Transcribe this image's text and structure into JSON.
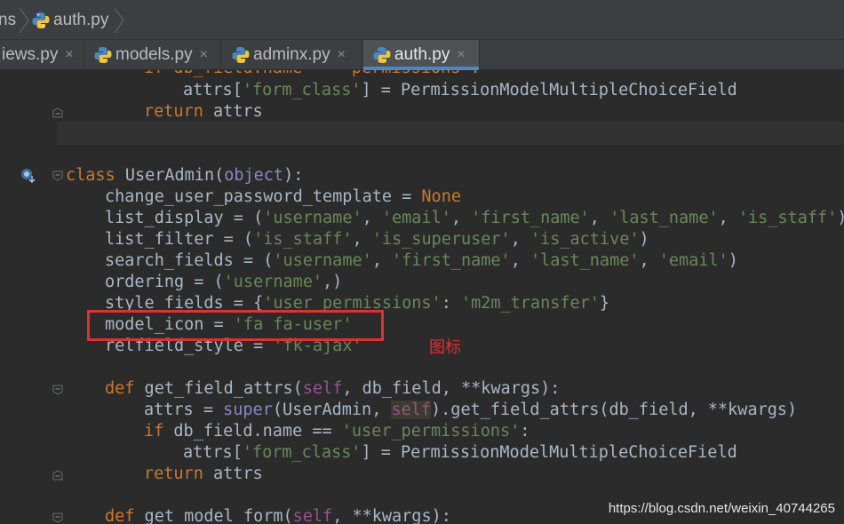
{
  "breadcrumb": {
    "items": [
      {
        "label": "ns"
      },
      {
        "label": "auth.py"
      }
    ]
  },
  "tabs": [
    {
      "label": "iews.py",
      "active": false
    },
    {
      "label": "models.py",
      "active": false
    },
    {
      "label": "adminx.py",
      "active": false
    },
    {
      "label": "auth.py",
      "active": true
    }
  ],
  "close_glyph": "×",
  "code": {
    "lines": [
      [
        [
          "if db_field.name == 'permissions':",
          "kw"
        ]
      ],
      [
        [
          "attrs[",
          ""
        ],
        [
          "'form_class'",
          "str"
        ],
        [
          "] = PermissionModelMultipleChoiceField",
          ""
        ]
      ],
      [
        [
          "return",
          "kw"
        ],
        [
          " attrs",
          ""
        ]
      ],
      [],
      [
        [
          "class",
          "kw"
        ],
        [
          " UserAdmin(",
          ""
        ],
        [
          "object",
          "bi"
        ],
        [
          "):",
          ""
        ]
      ],
      [
        [
          "change_user_password_template = ",
          ""
        ],
        [
          "None",
          "kw"
        ]
      ],
      [
        [
          "list_display = (",
          ""
        ],
        [
          "'username'",
          "str"
        ],
        [
          ", ",
          ""
        ],
        [
          "'email'",
          "str"
        ],
        [
          ", ",
          ""
        ],
        [
          "'first_name'",
          "str"
        ],
        [
          ", ",
          ""
        ],
        [
          "'last_name'",
          "str"
        ],
        [
          ", ",
          ""
        ],
        [
          "'is_staff'",
          "str"
        ],
        [
          ")",
          ""
        ]
      ],
      [
        [
          "list_filter = (",
          ""
        ],
        [
          "'is_staff'",
          "str"
        ],
        [
          ", ",
          ""
        ],
        [
          "'is_superuser'",
          "str"
        ],
        [
          ", ",
          ""
        ],
        [
          "'is_active'",
          "str"
        ],
        [
          ")",
          ""
        ]
      ],
      [
        [
          "search_fields = (",
          ""
        ],
        [
          "'username'",
          "str"
        ],
        [
          ", ",
          ""
        ],
        [
          "'first_name'",
          "str"
        ],
        [
          ", ",
          ""
        ],
        [
          "'last_name'",
          "str"
        ],
        [
          ", ",
          ""
        ],
        [
          "'email'",
          "str"
        ],
        [
          ")",
          ""
        ]
      ],
      [
        [
          "ordering = (",
          ""
        ],
        [
          "'username'",
          "str"
        ],
        [
          ",)",
          ""
        ]
      ],
      [
        [
          "style_fields = {",
          ""
        ],
        [
          "'user_permissions'",
          "str"
        ],
        [
          ": ",
          ""
        ],
        [
          "'m2m_transfer'",
          "str"
        ],
        [
          "}",
          ""
        ]
      ],
      [
        [
          "model_icon = ",
          ""
        ],
        [
          "'fa fa-user'",
          "str"
        ]
      ],
      [
        [
          "relfield_style = ",
          ""
        ],
        [
          "'fk-ajax'",
          "str"
        ]
      ],
      [],
      [
        [
          "def",
          "kw"
        ],
        [
          " get_field_attrs(",
          ""
        ],
        [
          "self",
          "self"
        ],
        [
          ", db_field, **kwargs):",
          ""
        ]
      ],
      [
        [
          "attrs = ",
          ""
        ],
        [
          "super",
          "bi"
        ],
        [
          "(UserAdmin, ",
          ""
        ],
        [
          "self",
          "self"
        ],
        [
          ").get_field_attrs(db_field, **kwargs)",
          ""
        ]
      ],
      [
        [
          "if",
          "kw"
        ],
        [
          " db_field.name == ",
          ""
        ],
        [
          "'user_permissions'",
          "str"
        ],
        [
          ":",
          ""
        ]
      ],
      [
        [
          "attrs[",
          ""
        ],
        [
          "'form_class'",
          "str"
        ],
        [
          "] = PermissionModelMultipleChoiceField",
          ""
        ]
      ],
      [
        [
          "return",
          "kw"
        ],
        [
          " attrs",
          ""
        ]
      ],
      [],
      [
        [
          "def",
          "kw"
        ],
        [
          " get_model_form(",
          ""
        ],
        [
          "self",
          "self"
        ],
        [
          ", **kwargs):",
          ""
        ]
      ]
    ]
  },
  "annotation": {
    "text": "图标"
  },
  "watermark": {
    "text": "https://blog.csdn.net/weixin_40744265"
  },
  "colors": {
    "background": "#2b2b2b",
    "keyword": "#cc7832",
    "string": "#6a8759",
    "self": "#94558d",
    "default_text": "#a9b7c6",
    "highlight_box": "#e03030",
    "active_tab_underline": "#4a88c7"
  },
  "icons": {
    "python_file": "python-file-icon",
    "breadcrumb_separator": "chevron-right-icon",
    "fold_marker": "fold-marker-icon",
    "gutter_override": "override-method-icon",
    "tab_close": "close-icon"
  }
}
